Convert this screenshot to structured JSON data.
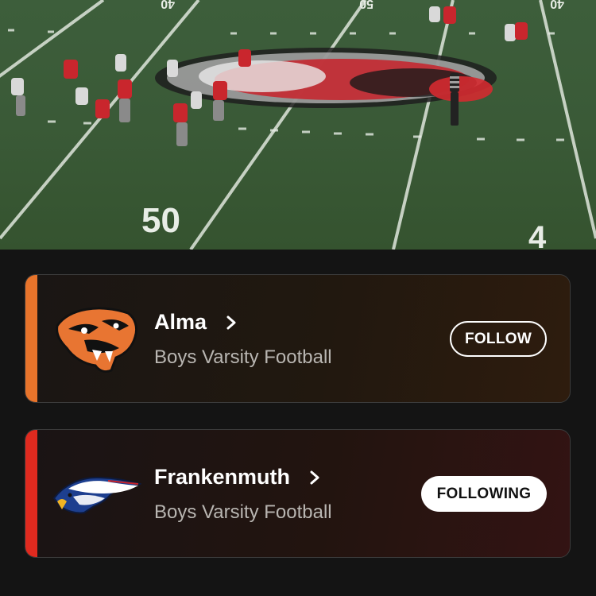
{
  "video": {
    "yard_numbers": [
      "50",
      "4",
      "40",
      "50",
      "40"
    ]
  },
  "teams": [
    {
      "name": "Alma",
      "sport": "Boys Varsity Football",
      "button_label": "FOLLOW",
      "following": false,
      "accent_color": "#e8742b",
      "logo_icon": "panther-icon"
    },
    {
      "name": "Frankenmuth",
      "sport": "Boys Varsity Football",
      "button_label": "FOLLOWING",
      "following": true,
      "accent_color": "#e02a1f",
      "logo_icon": "eagle-icon"
    }
  ]
}
